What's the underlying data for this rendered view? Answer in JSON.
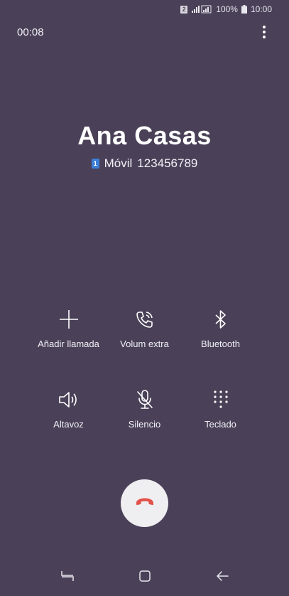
{
  "status_bar": {
    "sim_slot": "2",
    "battery_percent": "100%",
    "time": "10:00"
  },
  "call": {
    "timer": "00:08",
    "contact_name": "Ana Casas",
    "sim_number": "1",
    "number_type": "Móvil",
    "phone_number": "123456789"
  },
  "actions": [
    {
      "label": "Añadir llamada",
      "icon": "add-icon"
    },
    {
      "label": "Volum extra",
      "icon": "volume-boost-icon"
    },
    {
      "label": "Bluetooth",
      "icon": "bluetooth-icon"
    },
    {
      "label": "Altavoz",
      "icon": "speaker-icon"
    },
    {
      "label": "Silencio",
      "icon": "mute-mic-icon"
    },
    {
      "label": "Teclado",
      "icon": "keypad-icon"
    }
  ],
  "colors": {
    "background": "#4a4158",
    "end_call_icon": "#e2524a",
    "end_call_button": "#efeef1"
  }
}
